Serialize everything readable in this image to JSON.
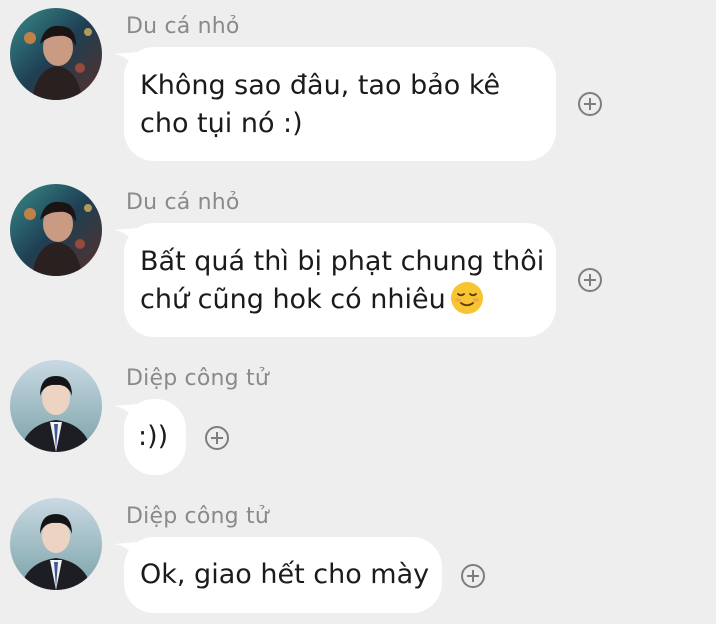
{
  "messages": [
    {
      "sender": "Du cá nhỏ",
      "avatar_icon": "avatar-du-ca-nho",
      "lines": [
        "Không sao đâu, tao bảo kê",
        "cho tụi nó :)"
      ]
    },
    {
      "sender": "Du cá nhỏ",
      "avatar_icon": "avatar-du-ca-nho",
      "lines": [
        "Bất quá thì bị phạt chung thôi",
        "chứ cũng hok có nhiêu"
      ],
      "emoji": "relieved-face-emoji"
    },
    {
      "sender": "Diệp công tử",
      "avatar_icon": "avatar-diep-cong-tu",
      "lines": [
        ":))"
      ]
    },
    {
      "sender": "Diệp công tử",
      "avatar_icon": "avatar-diep-cong-tu",
      "lines": [
        "Ok, giao hết cho mày"
      ]
    }
  ],
  "colors": {
    "background": "#eeeeee",
    "bubble": "#ffffff",
    "sender_text": "#8a8a8a",
    "message_text": "#1b1b1b",
    "react_icon": "#7d7d7d"
  }
}
